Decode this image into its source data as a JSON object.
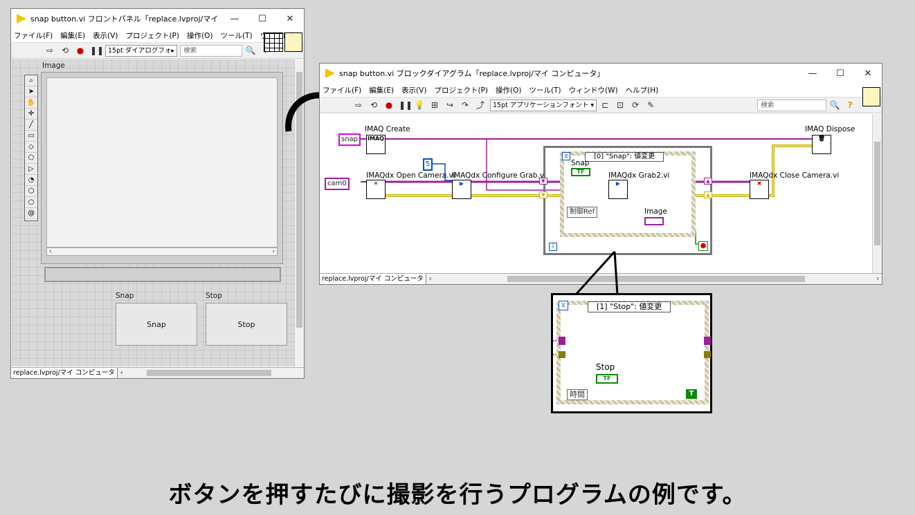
{
  "front_panel": {
    "title": "snap button.vi フロントパネル「replace.lvproj/マイ コンピュー...",
    "menus": [
      "ファイル(F)",
      "編集(E)",
      "表示(V)",
      "プロジェクト(P)",
      "操作(O)",
      "ツール(T)",
      "ウィンドウ"
    ],
    "font_selector": "15pt ダイアログフォ▸",
    "search_placeholder": "検索",
    "image_label": "Image",
    "snap_label": "Snap",
    "snap_button": "Snap",
    "stop_label": "Stop",
    "stop_button": "Stop",
    "project": "replace.lvproj/マイ コンピュータ"
  },
  "block_diagram": {
    "title": "snap button.vi ブロックダイアグラム「replace.lvproj/マイ コンピュータ」",
    "menus": [
      "ファイル(F)",
      "編集(E)",
      "表示(V)",
      "プロジェクト(P)",
      "操作(O)",
      "ツール(T)",
      "ウィンドウ(W)",
      "ヘルプ(H)"
    ],
    "font_selector": "15pt アプリケーションフォント ▾",
    "search_placeholder": "検索",
    "project": "replace.lvproj/マイ コンピュータ",
    "nodes": {
      "imaq_create": "IMAQ Create",
      "imaq_create_icon": "IMAQ",
      "imaqdx_open": "IMAQdx Open Camera.vi",
      "imaqdx_configure": "IMAQdx Configure Grab.vi",
      "imaqdx_grab": "IMAQdx Grab2.vi",
      "imaqdx_close": "IMAQdx Close Camera.vi",
      "imaq_dispose": "IMAQ Dispose",
      "snap_const": "snap",
      "cam_const": "cam0",
      "buffer_const": "5",
      "case_selector": "[0] \"Snap\": 値変更",
      "snap_terminal": "Snap",
      "image_terminal": "Image",
      "ctrl_ref": "制御Ref",
      "loop_index": "i"
    }
  },
  "zoom_case": {
    "selector": "[1] \"Stop\": 値変更",
    "stop_terminal": "Stop",
    "time_ref": "時間",
    "true_const": "T"
  },
  "caption": "ボタンを押すたびに撮影を行うプログラムの例です。",
  "colors": {
    "wire_image": "#9c1f9c",
    "wire_error": "#c8b400",
    "boolean": "#0a8a0a",
    "loop_border": "#777777"
  }
}
